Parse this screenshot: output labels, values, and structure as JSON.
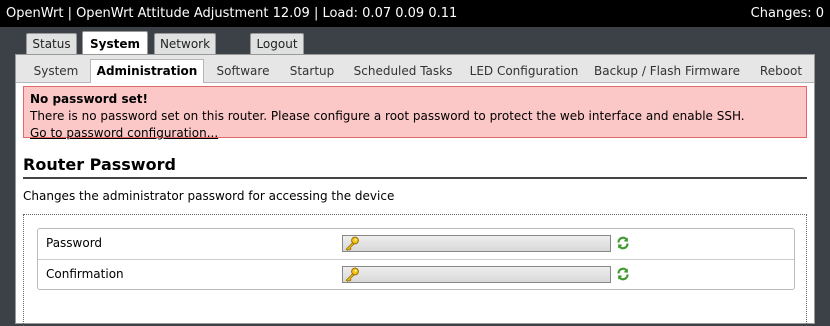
{
  "header": {
    "title": "OpenWrt | OpenWrt Attitude Adjustment 12.09 | Load: 0.07 0.09 0.11",
    "changes": "Changes: 0"
  },
  "main_tabs": [
    "Status",
    "System",
    "Network",
    "Logout"
  ],
  "active_main_tab": "System",
  "sub_tabs": [
    "System",
    "Administration",
    "Software",
    "Startup",
    "Scheduled Tasks",
    "LED Configuration",
    "Backup / Flash Firmware",
    "Reboot"
  ],
  "active_sub_tab": "Administration",
  "alert": {
    "title": "No password set!",
    "message": "There is no password set on this router. Please configure a root password to protect the web interface and enable SSH.",
    "link": "Go to password configuration..."
  },
  "section": {
    "title": "Router Password",
    "description": "Changes the administrator password for accessing the device"
  },
  "fields": [
    {
      "label": "Password",
      "value": "",
      "icon": "key-icon",
      "action_icon": "reveal-password-icon"
    },
    {
      "label": "Confirmation",
      "value": "",
      "icon": "key-icon",
      "action_icon": "reveal-password-icon"
    }
  ],
  "colors": {
    "header_bg": "#000000",
    "page_bg": "#3c4148",
    "alert_bg": "#fcc7c7",
    "alert_border": "#e06868",
    "section_rule": "#444444"
  }
}
